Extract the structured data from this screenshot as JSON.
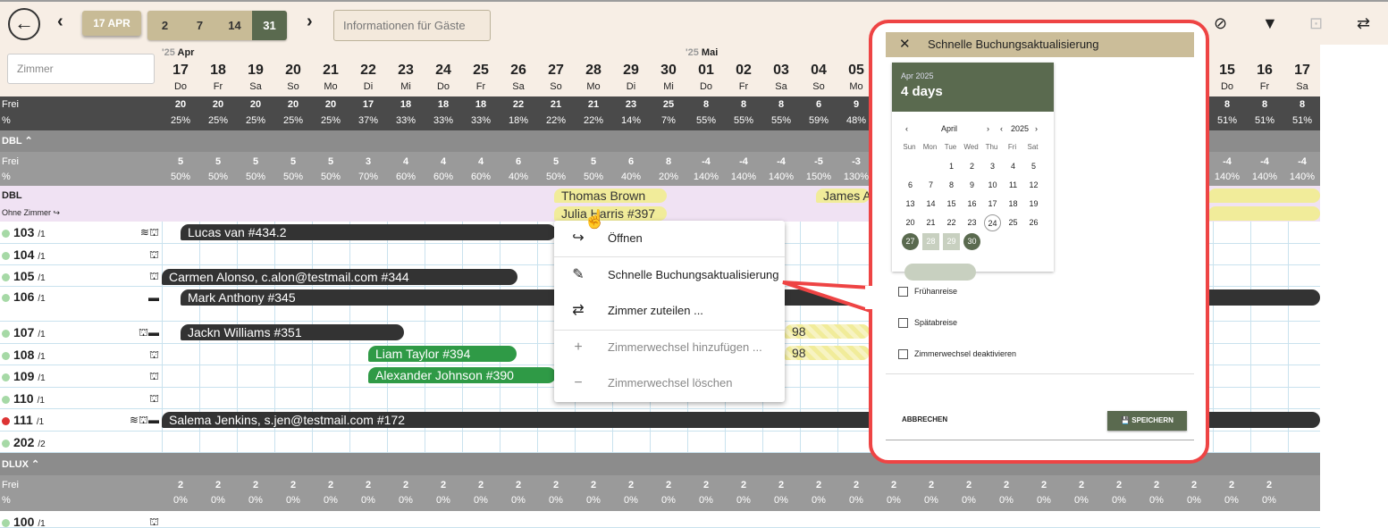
{
  "toolbar": {
    "back_icon": "arrow-left-icon",
    "date_label": "17 APR",
    "ranges": [
      "2",
      "7",
      "14",
      "31"
    ],
    "active_range": "31",
    "info_placeholder": "Informationen für Gäste",
    "filter_icons": [
      "filter-remove-icon",
      "filter-icon",
      "focus-icon",
      "assign-room-icon"
    ]
  },
  "search": {
    "placeholder": "Zimmer"
  },
  "months": [
    {
      "year": "'25",
      "name": "Apr"
    },
    {
      "year": "'25",
      "name": "Mai"
    }
  ],
  "days": [
    {
      "n": "17",
      "w": "Do"
    },
    {
      "n": "18",
      "w": "Fr"
    },
    {
      "n": "19",
      "w": "Sa"
    },
    {
      "n": "20",
      "w": "So"
    },
    {
      "n": "21",
      "w": "Mo"
    },
    {
      "n": "22",
      "w": "Di"
    },
    {
      "n": "23",
      "w": "Mi"
    },
    {
      "n": "24",
      "w": "Do"
    },
    {
      "n": "25",
      "w": "Fr"
    },
    {
      "n": "26",
      "w": "Sa"
    },
    {
      "n": "27",
      "w": "So"
    },
    {
      "n": "28",
      "w": "Mo"
    },
    {
      "n": "29",
      "w": "Di"
    },
    {
      "n": "30",
      "w": "Mi"
    },
    {
      "n": "01",
      "w": "Do"
    },
    {
      "n": "02",
      "w": "Fr"
    },
    {
      "n": "03",
      "w": "Sa"
    },
    {
      "n": "04",
      "w": "So"
    },
    {
      "n": "05",
      "w": "Mo"
    },
    {
      "n": "15",
      "w": "Do"
    },
    {
      "n": "16",
      "w": "Fr"
    },
    {
      "n": "17",
      "w": "Sa"
    }
  ],
  "total": {
    "label": "Frei",
    "pct_label": "%",
    "frei": [
      "20",
      "20",
      "20",
      "20",
      "20",
      "17",
      "18",
      "18",
      "18",
      "22",
      "21",
      "21",
      "23",
      "25",
      "8",
      "8",
      "8",
      "6",
      "9",
      "8",
      "8",
      "8"
    ],
    "pct": [
      "25%",
      "25%",
      "25%",
      "25%",
      "25%",
      "37%",
      "33%",
      "33%",
      "33%",
      "18%",
      "22%",
      "22%",
      "14%",
      "7%",
      "55%",
      "55%",
      "55%",
      "59%",
      "48%",
      "51%",
      "51%",
      "51%"
    ]
  },
  "dbl": {
    "label": "DBL",
    "frei_label": "Frei",
    "pct_label": "%",
    "frei": [
      "5",
      "5",
      "5",
      "5",
      "5",
      "3",
      "4",
      "4",
      "4",
      "6",
      "5",
      "5",
      "6",
      "8",
      "-4",
      "-4",
      "-4",
      "-5",
      "-3",
      "-4",
      "-4",
      "-4"
    ],
    "pct": [
      "50%",
      "50%",
      "50%",
      "50%",
      "50%",
      "70%",
      "60%",
      "60%",
      "60%",
      "40%",
      "50%",
      "50%",
      "40%",
      "20%",
      "140%",
      "140%",
      "140%",
      "150%",
      "130%",
      "140%",
      "140%",
      "140%"
    ],
    "unassigned_title": "DBL",
    "unassigned_sub": "Ohne Zimmer"
  },
  "unassigned": [
    "Thomas Brown",
    "Julia Harris #397",
    "James A"
  ],
  "rooms": [
    {
      "num": "103",
      "cap": "/1",
      "icons": "≋⛫",
      "status": "green"
    },
    {
      "num": "104",
      "cap": "/1",
      "icons": "⛫",
      "status": "green"
    },
    {
      "num": "105",
      "cap": "/1",
      "icons": "⛫",
      "status": "green"
    },
    {
      "num": "106",
      "cap": "/1",
      "icons": "▬",
      "status": "green"
    },
    {
      "num": "107",
      "cap": "/1",
      "icons": "⛫▬",
      "status": "green"
    },
    {
      "num": "108",
      "cap": "/1",
      "icons": "⛫",
      "status": "green"
    },
    {
      "num": "109",
      "cap": "/1",
      "icons": "⛫",
      "status": "green"
    },
    {
      "num": "110",
      "cap": "/1",
      "icons": "⛫",
      "status": "green"
    },
    {
      "num": "111",
      "cap": "/1",
      "icons": "≋⛫▬",
      "status": "red"
    },
    {
      "num": "202",
      "cap": "/2",
      "icons": "",
      "status": "green"
    },
    {
      "num": "100",
      "cap": "/1",
      "icons": "⛫",
      "status": "green"
    }
  ],
  "bookings": [
    "Lucas van #434.2",
    "Carmen Alonso, c.alon@testmail.com #344",
    "Mark Anthony #345",
    "Jackn Williams #351",
    "Liam Taylor #394",
    "Alexander Johnson #390",
    "Salema Jenkins, s.jen@testmail.com #172",
    "98",
    "98"
  ],
  "dlux": {
    "label": "DLUX",
    "frei_label": "Frei",
    "pct_label": "%",
    "frei": "2",
    "pct": "0%"
  },
  "context_menu": [
    {
      "label": "Öffnen",
      "icon": "forward-arrow-icon",
      "enabled": true
    },
    {
      "label": "Schnelle Buchungsaktualisierung ...",
      "icon": "pencil-icon",
      "enabled": true
    },
    {
      "label": "Zimmer zuteilen ...",
      "icon": "assign-room-icon",
      "enabled": true
    },
    {
      "label": "Zimmerwechsel hinzufügen ...",
      "icon": "plus-icon",
      "enabled": false
    },
    {
      "label": "Zimmerwechsel löschen",
      "icon": "minus-icon",
      "enabled": false
    }
  ],
  "panel": {
    "title": "Schnelle Buchungsaktualisierung",
    "cal_year": "Apr 2025",
    "cal_title": "4 days",
    "month": "April",
    "year": "2025",
    "weekdays": [
      "Sun",
      "Mon",
      "Tue",
      "Wed",
      "Thu",
      "Fri",
      "Sat"
    ],
    "today": "24",
    "selected_start": "27",
    "selected_end": "30",
    "checkboxes": [
      "Frühanreise",
      "Spätabreise",
      "Zimmerwechsel deaktivieren"
    ],
    "cancel": "ABBRECHEN",
    "save": "SPEICHERN"
  }
}
